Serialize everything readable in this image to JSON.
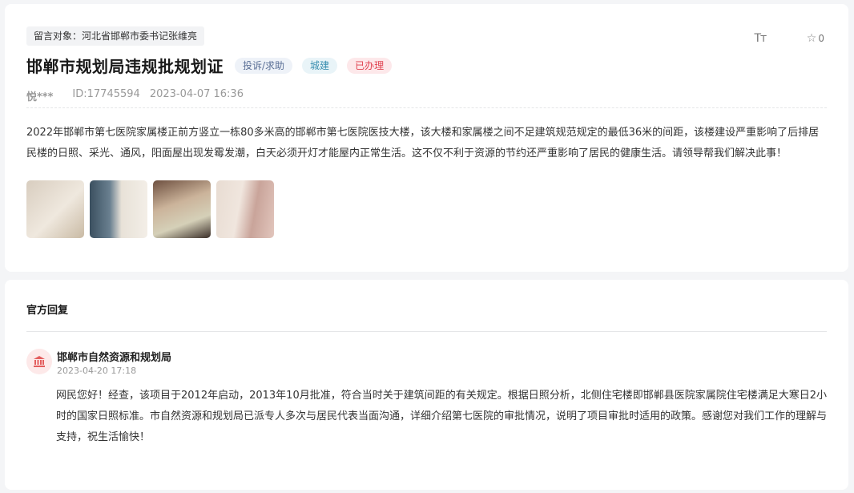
{
  "post": {
    "target_label": "留言对象：河北省邯郸市委书记张维亮",
    "font_icon": "Tт",
    "favorite_icon": "star-outline",
    "favorite_count": "0",
    "title": "邯郸市规划局违规批规划证",
    "tags": {
      "type": "投诉/求助",
      "category": "城建",
      "status": "已办理"
    },
    "author": "悦***",
    "post_id": "ID:17745594",
    "datetime": "2023-04-07 16:36",
    "content": "2022年邯郸市第七医院家属楼正前方竖立一栋80多米高的邯郸市第七医院医技大楼，该大楼和家属楼之间不足建筑规范规定的最低36米的间距，该楼建设严重影响了后排居民楼的日照、采光、通风，阳面屋出现发霉发潮，白天必须开灯才能屋内正常生活。这不仅不利于资源的节约还严重影响了居民的健康生活。请领导帮我们解决此事！",
    "images": [
      "wall-mold-photo",
      "window-corner-photo",
      "room-interior-photo",
      "curtain-wall-photo"
    ]
  },
  "reply": {
    "heading": "官方回复",
    "org_icon": "government-building-icon",
    "org_name": "邯郸市自然资源和规划局",
    "datetime": "2023-04-20 17:18",
    "content": "网民您好！经查，该项目于2012年启动，2013年10月批准，符合当时关于建筑间距的有关规定。根据日照分析，北侧住宅楼即邯郸县医院家属院住宅楼满足大寒日2小时的国家日照标准。市自然资源和规划局已派专人多次与居民代表当面沟通，详细介绍第七医院的审批情况，说明了项目审批时适用的政策。感谢您对我们工作的理解与支持，祝生活愉快！"
  },
  "colors": {
    "status_red": "#e0414f",
    "category_blue": "#3b8fb0",
    "type_slate": "#5a6f96",
    "org_icon_red": "#e35d5d"
  }
}
